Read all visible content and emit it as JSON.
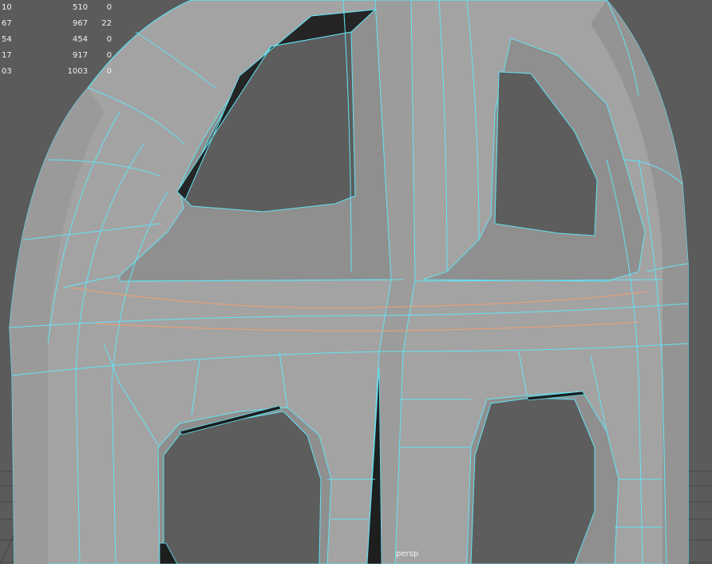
{
  "viewport": {
    "camera": "persp",
    "colors": {
      "background": "#5b5b5b",
      "grid": "#4a4a4a",
      "surface": "#a3a3a3",
      "surface_dark": "#7d7d7d",
      "hole": "#5e5e5e",
      "wireframe": "#62e4f4",
      "selected_edge": "#f0a070"
    }
  },
  "hud": {
    "rows": [
      {
        "a": "10",
        "b": "510",
        "c": "0"
      },
      {
        "a": "67",
        "b": "967",
        "c": "22"
      },
      {
        "a": "54",
        "b": "454",
        "c": "0"
      },
      {
        "a": "17",
        "b": "917",
        "c": "0"
      },
      {
        "a": "03",
        "b": "1003",
        "c": "0"
      }
    ]
  }
}
